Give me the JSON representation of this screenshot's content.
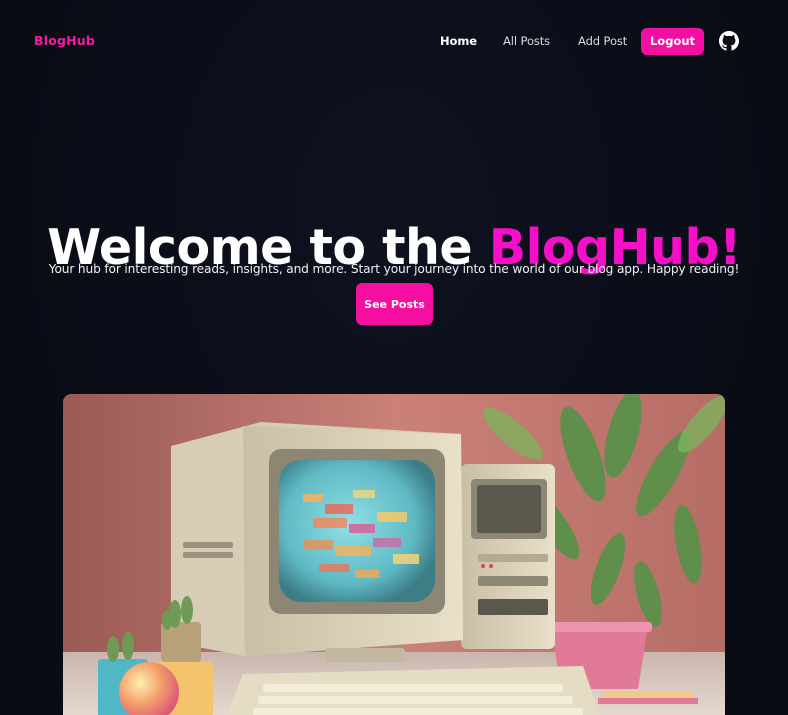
{
  "nav": {
    "brand": "BlogHub",
    "links": [
      {
        "label": "Home",
        "active": true
      },
      {
        "label": "All Posts",
        "active": false
      },
      {
        "label": "Add Post",
        "active": false
      }
    ],
    "logout_label": "Logout",
    "github_icon": "github-icon"
  },
  "hero": {
    "title_prefix": "Welcome to the ",
    "title_accent": "BlogHub!",
    "subtitle": "Your hub for interesting reads, insights, and more. Start your journey into the world of our blog app. Happy reading!",
    "cta_label": "See Posts"
  },
  "colors": {
    "background": "#0a0d17",
    "accent": "#f50fa0",
    "brand": "#f7199f"
  }
}
